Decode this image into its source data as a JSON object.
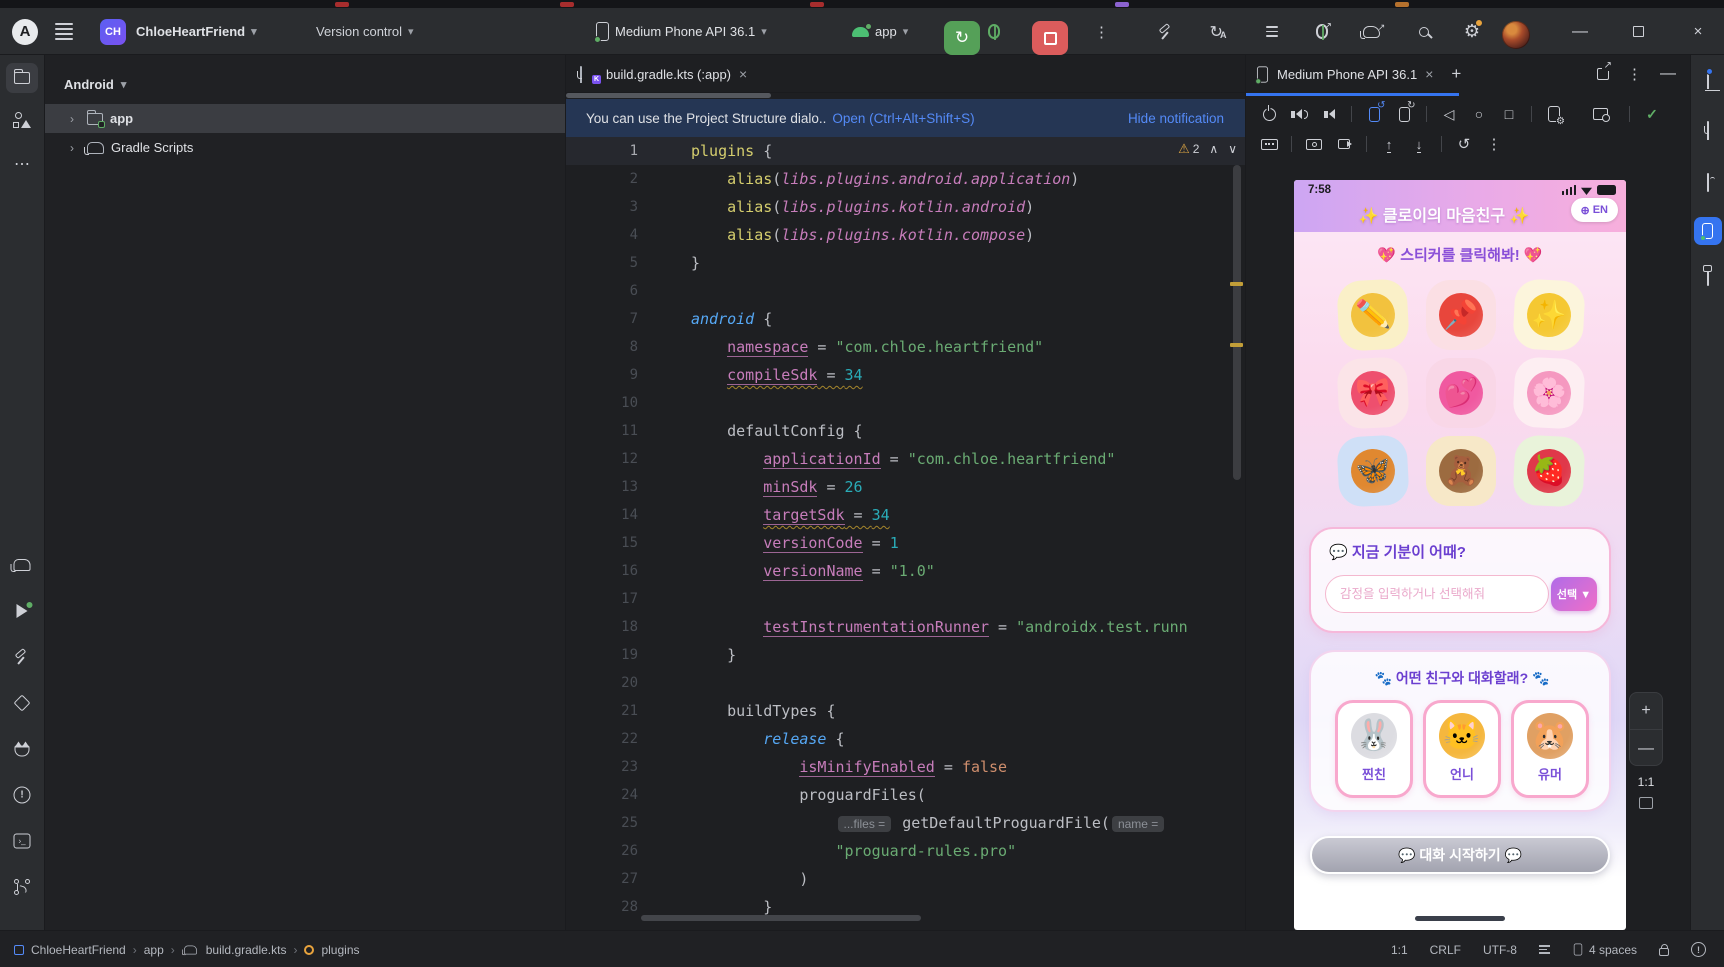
{
  "glyphs": {
    "chevron_down": "▾",
    "close": "×",
    "plus": "+",
    "minus": "—",
    "kebab": "⋮",
    "more": "⋯",
    "back": "◁",
    "home": "○",
    "square": "□",
    "check": "✓",
    "warning": "⚠",
    "gear": "⚙",
    "up_chev": "∧",
    "down_chev": "∨",
    "tree_chev": "›",
    "crumb_sep": "›",
    "rerun": "↻",
    "reset": "↺",
    "upload": "↑",
    "download": "↓",
    "globe": "⊕",
    "logo_letter": "A",
    "bang": "!",
    "terminal": "›_",
    "dropdown_arrow": "▼"
  },
  "title_bar": {
    "project_initials": "CH",
    "project_name": "ChloeHeartFriend",
    "version_control": "Version control",
    "device": "Medium Phone API 36.1",
    "run_config": "app"
  },
  "project_panel": {
    "view": "Android",
    "rows": [
      {
        "label": "app"
      },
      {
        "label": "Gradle Scripts"
      }
    ]
  },
  "editor": {
    "tab_label": "build.gradle.kts (:app)",
    "banner": {
      "message": "You can use the Project Structure dialo..",
      "action": "Open (Ctrl+Alt+Shift+S)",
      "dismiss": "Hide notification"
    },
    "warnings": {
      "count": "2"
    },
    "code": {
      "lines": [
        {
          "n": 1,
          "a": true,
          "seg": [
            [
              "fn",
              "plugins"
            ],
            [
              "pl",
              " {"
            ]
          ]
        },
        {
          "n": 2,
          "seg": [
            [
              "pl",
              "    "
            ],
            [
              "fn",
              "alias"
            ],
            [
              "pl",
              "("
            ],
            [
              "ch",
              "libs.plugins.android.application"
            ],
            [
              "pl",
              ")"
            ]
          ]
        },
        {
          "n": 3,
          "seg": [
            [
              "pl",
              "    "
            ],
            [
              "fn",
              "alias"
            ],
            [
              "pl",
              "("
            ],
            [
              "ch",
              "libs.plugins.kotlin.android"
            ],
            [
              "pl",
              ")"
            ]
          ]
        },
        {
          "n": 4,
          "seg": [
            [
              "pl",
              "    "
            ],
            [
              "fn",
              "alias"
            ],
            [
              "pl",
              "("
            ],
            [
              "ch",
              "libs.plugins.kotlin.compose"
            ],
            [
              "pl",
              ")"
            ]
          ]
        },
        {
          "n": 5,
          "seg": [
            [
              "pl",
              "}"
            ]
          ]
        },
        {
          "n": 6,
          "seg": []
        },
        {
          "n": 7,
          "seg": [
            [
              "kw",
              "android"
            ],
            [
              "pl",
              " {"
            ]
          ]
        },
        {
          "n": 8,
          "seg": [
            [
              "pl",
              "    "
            ],
            [
              "pr",
              "namespace"
            ],
            [
              "pl",
              " = "
            ],
            [
              "st",
              "\"com.chloe.heartfriend\""
            ]
          ]
        },
        {
          "n": 9,
          "seg": [
            [
              "pl",
              "    "
            ],
            [
              "prw",
              "compileSdk"
            ],
            [
              "plw",
              " = "
            ],
            [
              "nuw",
              "34"
            ]
          ]
        },
        {
          "n": 10,
          "seg": []
        },
        {
          "n": 11,
          "seg": [
            [
              "pl",
              "    defaultConfig {"
            ]
          ]
        },
        {
          "n": 12,
          "seg": [
            [
              "pl",
              "        "
            ],
            [
              "pr",
              "applicationId"
            ],
            [
              "pl",
              " = "
            ],
            [
              "st",
              "\"com.chloe.heartfriend\""
            ]
          ]
        },
        {
          "n": 13,
          "seg": [
            [
              "pl",
              "        "
            ],
            [
              "pr",
              "minSdk"
            ],
            [
              "pl",
              " = "
            ],
            [
              "nu",
              "26"
            ]
          ]
        },
        {
          "n": 14,
          "seg": [
            [
              "pl",
              "        "
            ],
            [
              "prw",
              "targetSdk"
            ],
            [
              "plw",
              " = "
            ],
            [
              "nuw",
              "34"
            ]
          ]
        },
        {
          "n": 15,
          "seg": [
            [
              "pl",
              "        "
            ],
            [
              "pr",
              "versionCode"
            ],
            [
              "pl",
              " = "
            ],
            [
              "nu",
              "1"
            ]
          ]
        },
        {
          "n": 16,
          "seg": [
            [
              "pl",
              "        "
            ],
            [
              "pr",
              "versionName"
            ],
            [
              "pl",
              " = "
            ],
            [
              "st",
              "\"1.0\""
            ]
          ]
        },
        {
          "n": 17,
          "seg": []
        },
        {
          "n": 18,
          "seg": [
            [
              "pl",
              "        "
            ],
            [
              "pr",
              "testInstrumentationRunner"
            ],
            [
              "pl",
              " = "
            ],
            [
              "st",
              "\"androidx.test.runn"
            ]
          ]
        },
        {
          "n": 19,
          "seg": [
            [
              "pl",
              "    }"
            ]
          ]
        },
        {
          "n": 20,
          "seg": []
        },
        {
          "n": 21,
          "seg": [
            [
              "pl",
              "    buildTypes {"
            ]
          ]
        },
        {
          "n": 22,
          "seg": [
            [
              "pl",
              "        "
            ],
            [
              "kw",
              "release"
            ],
            [
              "pl",
              " {"
            ]
          ]
        },
        {
          "n": 23,
          "seg": [
            [
              "pl",
              "            "
            ],
            [
              "pr",
              "isMinifyEnabled"
            ],
            [
              "pl",
              " = "
            ],
            [
              "bo",
              "false"
            ]
          ]
        },
        {
          "n": 24,
          "seg": [
            [
              "pl",
              "            proguardFiles("
            ]
          ]
        },
        {
          "n": 25,
          "seg": [
            [
              "pl",
              "                "
            ],
            [
              "hi",
              "...files ="
            ],
            [
              "pl",
              " getDefaultProguardFile("
            ],
            [
              "hi",
              "name ="
            ]
          ]
        },
        {
          "n": 26,
          "seg": [
            [
              "pl",
              "                "
            ],
            [
              "st",
              "\"proguard-rules.pro\""
            ]
          ]
        },
        {
          "n": 27,
          "seg": [
            [
              "pl",
              "            )"
            ]
          ]
        },
        {
          "n": 28,
          "seg": [
            [
              "pl",
              "        }"
            ]
          ]
        }
      ]
    }
  },
  "device_panel": {
    "tab_label": "Medium Phone API 36.1",
    "zoom_level": "1:1"
  },
  "phone": {
    "status_time": "7:58",
    "header_title": "✨ 클로이의 마음친구 ✨",
    "language_button": "EN",
    "sticker_prompt": "💖 스티커를 클릭해봐! 💖",
    "stickers": [
      {
        "emoji": "✏️",
        "tile": "#faf0c8",
        "blob": "#f2c23e"
      },
      {
        "emoji": "📌",
        "tile": "#fbdfe4",
        "blob": "#e8463c"
      },
      {
        "emoji": "✨",
        "tile": "#fcf5dc",
        "blob": "#f5c832"
      },
      {
        "emoji": "🎀",
        "tile": "#fbe4e8",
        "blob": "#ee4f6e"
      },
      {
        "emoji": "💕",
        "tile": "#f9d7e7",
        "blob": "#f059a0"
      },
      {
        "emoji": "🌸",
        "tile": "#fdeef2",
        "blob": "#f598c0"
      },
      {
        "emoji": "🦋",
        "tile": "#cfe0f7",
        "blob": "#e08830"
      },
      {
        "emoji": "🧸",
        "tile": "#f7e8c8",
        "blob": "#9c6b40"
      },
      {
        "emoji": "🍓",
        "tile": "#e9f3da",
        "blob": "#e0384a"
      }
    ],
    "mood": {
      "title": "💬 지금 기분이 어때?",
      "placeholder": "감정을 입력하거나 선택해줘",
      "select": "선택 ▼"
    },
    "friends": {
      "title": "🐾 어떤 친구와 대화할래? 🐾",
      "cards": [
        {
          "emoji": "🐰",
          "label": "찐친",
          "blob": "#dcdce1"
        },
        {
          "emoji": "🐱",
          "label": "언니",
          "blob": "#f5b73e"
        },
        {
          "emoji": "🐹",
          "label": "유머",
          "blob": "#e0a063"
        }
      ]
    },
    "start_button": "💬 대화 시작하기 💬"
  },
  "status_bar": {
    "crumbs": [
      "ChloeHeartFriend",
      "app",
      "build.gradle.kts",
      "plugins"
    ],
    "cursor": "1:1",
    "line_ending": "CRLF",
    "encoding": "UTF-8",
    "indent": "4 spaces"
  },
  "colors": {
    "accent_blue": "#3574F0",
    "run_green": "#55A058",
    "stop_red": "#DB5C5C",
    "link_blue": "#548AF7",
    "warning_yellow": "#C29E38",
    "selection_gray": "#3B3D42",
    "header_gradient_start": "#cda6f3",
    "header_gradient_end": "#f7afdc",
    "app_purple": "#6b3fd0"
  }
}
